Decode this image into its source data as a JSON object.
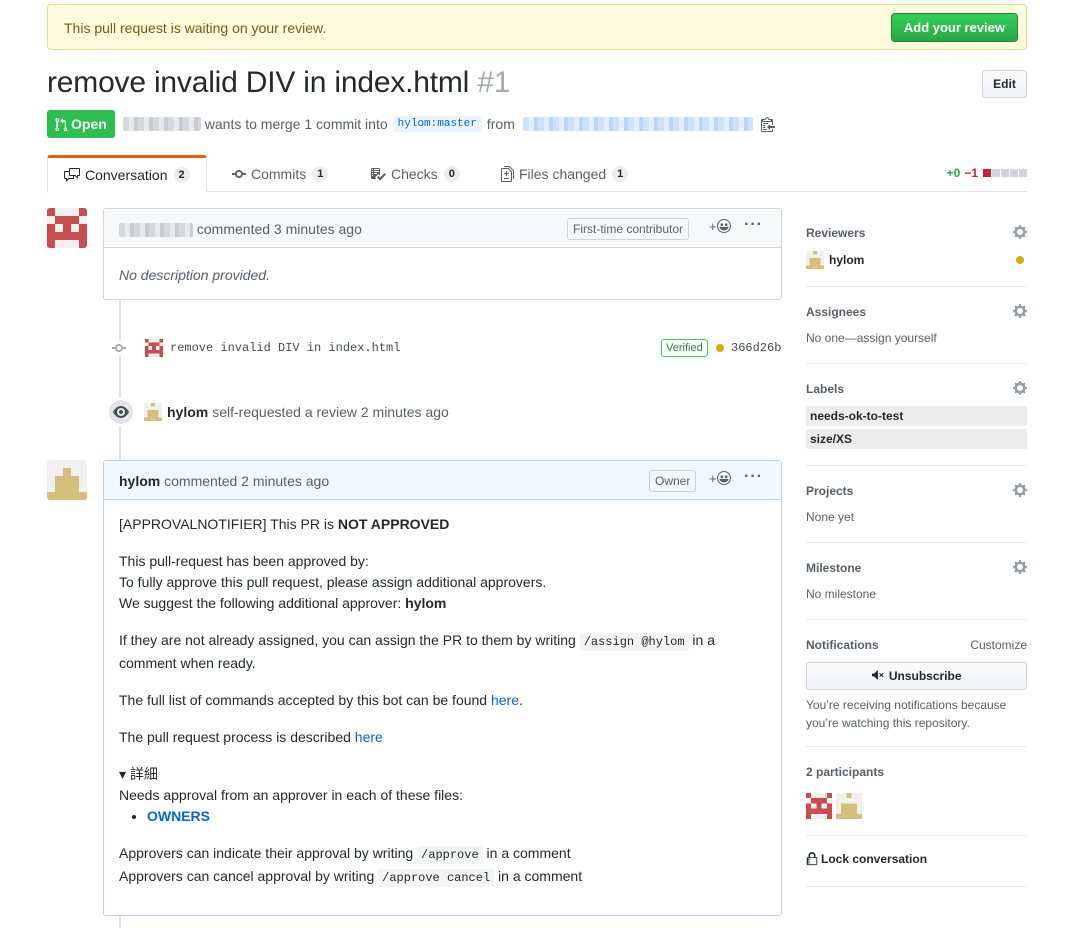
{
  "banner": {
    "text": "This pull request is waiting on your review.",
    "button": "Add your review"
  },
  "pr": {
    "title": "remove invalid DIV in index.html",
    "number": "#1",
    "edit": "Edit",
    "state": "Open",
    "merge_text": "wants to merge 1 commit into",
    "base_branch": "hylom:master",
    "from_text": "from"
  },
  "tabs": [
    {
      "label": "Conversation",
      "count": "2"
    },
    {
      "label": "Commits",
      "count": "1"
    },
    {
      "label": "Checks",
      "count": "0"
    },
    {
      "label": "Files changed",
      "count": "1"
    }
  ],
  "diffstat": {
    "add": "+0",
    "del": "−1"
  },
  "comment1": {
    "meta": "commented 3 minutes ago",
    "badge": "First-time contributor",
    "body": "No description provided."
  },
  "commit": {
    "message": "remove invalid DIV in index.html",
    "verified": "Verified",
    "sha": "366d26b"
  },
  "event": {
    "user": "hylom",
    "text": "self-requested a review 2 minutes ago"
  },
  "comment2": {
    "author": "hylom",
    "meta": "commented 2 minutes ago",
    "badge": "Owner",
    "p1_pre": "[APPROVALNOTIFIER] This PR is ",
    "p1_bold": "NOT APPROVED",
    "p2_l1": "This pull-request has been approved by:",
    "p2_l2": "To fully approve this pull request, please assign additional approvers.",
    "p2_l3_pre": "We suggest the following additional approver: ",
    "p2_l3_bold": "hylom",
    "p3_pre": "If they are not already assigned, you can assign the PR to them by writing ",
    "p3_code": "/assign @hylom",
    "p3_post": " in a comment when ready.",
    "p4_pre": "The full list of commands accepted by this bot can be found ",
    "p4_link": "here",
    "p4_post": ".",
    "p5_pre": "The pull request process is described ",
    "p5_link": "here",
    "details_summary": "▾ 詳細",
    "details_l1": "Needs approval from an approver in each of these files:",
    "details_item": "OWNERS",
    "p6_l1_pre": "Approvers can indicate their approval by writing ",
    "p6_l1_code": "/approve",
    "p6_l1_post": " in a comment",
    "p6_l2_pre": "Approvers can cancel approval by writing ",
    "p6_l2_code": "/approve cancel",
    "p6_l2_post": " in a comment"
  },
  "sidebar": {
    "reviewers": {
      "title": "Reviewers",
      "name": "hylom"
    },
    "assignees": {
      "title": "Assignees",
      "value": "No one—assign yourself"
    },
    "labels": {
      "title": "Labels",
      "items": [
        "needs-ok-to-test",
        "size/XS"
      ]
    },
    "projects": {
      "title": "Projects",
      "value": "None yet"
    },
    "milestone": {
      "title": "Milestone",
      "value": "No milestone"
    },
    "notifications": {
      "title": "Notifications",
      "customize": "Customize",
      "button": "Unsubscribe",
      "l1": "You’re receiving notifications because",
      "l2": "you’re watching this repository."
    },
    "participants": {
      "title": "2 participants"
    },
    "lock": "Lock conversation"
  },
  "colors": {
    "accent_green": "#28a745",
    "link": "#0366d6",
    "pending_dot": "#dbab09",
    "tab_active": "#e36209"
  }
}
